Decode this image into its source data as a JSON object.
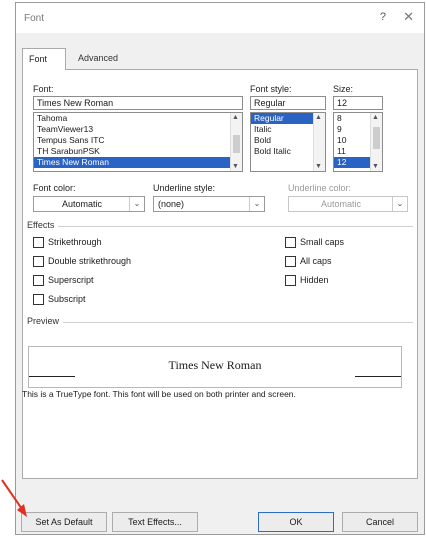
{
  "dialog": {
    "title": "Font",
    "help_label": "?",
    "close_label": "✕"
  },
  "tabs": [
    {
      "label": "Font",
      "active": true
    },
    {
      "label": "Advanced",
      "active": false
    }
  ],
  "font_section": {
    "font_label": "Font:",
    "style_label": "Font style:",
    "size_label": "Size:",
    "font_value": "Times New Roman",
    "style_value": "Regular",
    "size_value": "12",
    "font_list": [
      "Tahoma",
      "TeamViewer13",
      "Tempus Sans ITC",
      "TH SarabunPSK",
      "Times New Roman"
    ],
    "style_list": [
      "Regular",
      "Italic",
      "Bold",
      "Bold Italic"
    ],
    "size_list": [
      "8",
      "9",
      "10",
      "11",
      "12"
    ],
    "selected_font": "Times New Roman",
    "selected_style": "Regular",
    "selected_size": "12"
  },
  "color_row": {
    "font_color_label": "Font color:",
    "font_color_value": "Automatic",
    "underline_style_label": "Underline style:",
    "underline_style_value": "(none)",
    "underline_color_label": "Underline color:",
    "underline_color_value": "Automatic"
  },
  "effects": {
    "title": "Effects",
    "left": [
      "Strikethrough",
      "Double strikethrough",
      "Superscript",
      "Subscript"
    ],
    "right": [
      "Small caps",
      "All caps",
      "Hidden"
    ]
  },
  "preview": {
    "title": "Preview",
    "sample": "Times New Roman",
    "info": "This is a TrueType font. This font will be used on both printer and screen."
  },
  "buttons": {
    "set_default": "Set As Default",
    "text_effects": "Text Effects...",
    "ok": "OK",
    "cancel": "Cancel"
  },
  "colors": {
    "selection": "#2b63c4",
    "annotation_arrow": "#e03020",
    "ok_border": "#2d6bc4"
  }
}
